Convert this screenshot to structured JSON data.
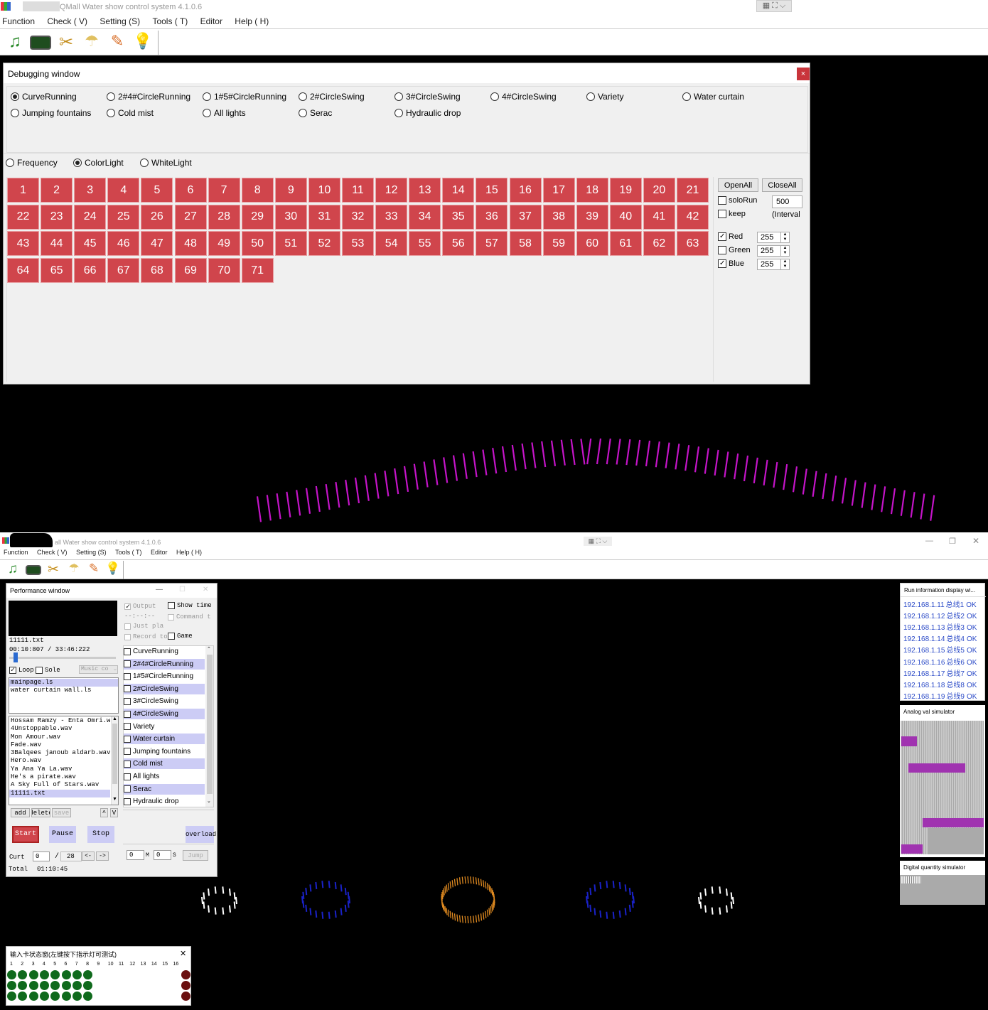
{
  "top": {
    "title": "QMall Water show control system 4.1.0.6",
    "menu": [
      "Function",
      "Check ( V)",
      "Setting (S)",
      "Tools ( T)",
      "Editor",
      "Help ( H)"
    ],
    "toolbar_icons": [
      "music-note-icon",
      "chip-board-icon",
      "tools-icon",
      "fountain-icon",
      "brush-icon",
      "bulb-icon"
    ]
  },
  "debug": {
    "title": "Debugging window",
    "close": "×",
    "effects": [
      {
        "label": "CurveRunning",
        "selected": true
      },
      {
        "label": "2#4#CircleRunning",
        "selected": false
      },
      {
        "label": "1#5#CircleRunning",
        "selected": false
      },
      {
        "label": "2#CircleSwing",
        "selected": false
      },
      {
        "label": "3#CircleSwing",
        "selected": false
      },
      {
        "label": "4#CircleSwing",
        "selected": false
      },
      {
        "label": "Variety",
        "selected": false
      },
      {
        "label": "Water curtain",
        "selected": false
      },
      {
        "label": "Jumping fountains",
        "selected": false
      },
      {
        "label": "Cold mist",
        "selected": false
      },
      {
        "label": "All lights",
        "selected": false
      },
      {
        "label": "Serac",
        "selected": false
      },
      {
        "label": "Hydraulic drop",
        "selected": false
      }
    ],
    "modes": [
      {
        "label": "Frequency",
        "selected": false
      },
      {
        "label": "ColorLight",
        "selected": true
      },
      {
        "label": "WhiteLight",
        "selected": false
      }
    ],
    "channels": [
      "1",
      "2",
      "3",
      "4",
      "5",
      "6",
      "7",
      "8",
      "9",
      "10",
      "11",
      "12",
      "13",
      "14",
      "15",
      "16",
      "17",
      "18",
      "19",
      "20",
      "21",
      "22",
      "23",
      "24",
      "25",
      "26",
      "27",
      "28",
      "29",
      "30",
      "31",
      "32",
      "33",
      "34",
      "35",
      "36",
      "37",
      "38",
      "39",
      "40",
      "41",
      "42",
      "43",
      "44",
      "45",
      "46",
      "47",
      "48",
      "49",
      "50",
      "51",
      "52",
      "53",
      "54",
      "55",
      "56",
      "57",
      "58",
      "59",
      "60",
      "61",
      "62",
      "63",
      "64",
      "65",
      "66",
      "67",
      "68",
      "69",
      "70",
      "71"
    ],
    "open_all": "OpenAll",
    "close_all": "CloseAll",
    "solo_run": "soloRun",
    "keep": "keep",
    "interval_value": "500",
    "interval_label": "(Interval",
    "colors": [
      {
        "label": "Red",
        "checked": true,
        "value": "255"
      },
      {
        "label": "Green",
        "checked": false,
        "value": "255"
      },
      {
        "label": "Blue",
        "checked": true,
        "value": "255"
      }
    ]
  },
  "bottom": {
    "title": "all Water show control system 4.1.0.6",
    "menu": [
      "Function",
      "Check ( V)",
      "Setting (S)",
      "Tools ( T)",
      "Editor",
      "Help ( H)"
    ],
    "perf": {
      "title": "Performance window",
      "file": "11111.txt",
      "time": "00:10:807 / 33:46:222",
      "progress": 0.02,
      "loop": "Loop",
      "sole": "Sole",
      "music_combo": "Music co",
      "output": "Output",
      "show_time": "Show time",
      "time_placeholder": "--:--:--",
      "command": "Command t",
      "just_play": "Just pla",
      "record_to": "Record to",
      "game": "Game",
      "scripts": [
        {
          "name": "mainpage.ls",
          "selected": true
        },
        {
          "name": "water curtain wall.ls",
          "selected": false
        }
      ],
      "songs": [
        {
          "name": "Hossam Ramzy - Enta Omri.wav",
          "selected": false
        },
        {
          "name": "4Unstoppable.wav",
          "selected": false
        },
        {
          "name": "Mon Amour.wav",
          "selected": false
        },
        {
          "name": "Fade.wav",
          "selected": false
        },
        {
          "name": "3Balqees janoub aldarb.wav",
          "selected": false
        },
        {
          "name": "Hero.wav",
          "selected": false
        },
        {
          "name": "Ya Ana Ya La.wav",
          "selected": false
        },
        {
          "name": "He's a pirate.wav",
          "selected": false
        },
        {
          "name": "A Sky Full of Stars.wav",
          "selected": false
        },
        {
          "name": "11111.txt",
          "selected": true
        }
      ],
      "effects": [
        {
          "label": "CurveRunning",
          "hl": false
        },
        {
          "label": "2#4#CircleRunning",
          "hl": true
        },
        {
          "label": "1#5#CircleRunning",
          "hl": false
        },
        {
          "label": "2#CircleSwing",
          "hl": true
        },
        {
          "label": "3#CircleSwing",
          "hl": false
        },
        {
          "label": "4#CircleSwing",
          "hl": true
        },
        {
          "label": "Variety",
          "hl": false
        },
        {
          "label": "Water curtain",
          "hl": true
        },
        {
          "label": "Jumping fountains",
          "hl": false
        },
        {
          "label": "Cold mist",
          "hl": true
        },
        {
          "label": "All lights",
          "hl": false
        },
        {
          "label": "Serac",
          "hl": true
        },
        {
          "label": "Hydraulic drop",
          "hl": false
        }
      ],
      "add": "add",
      "delete": "delete",
      "save": "save",
      "up": "^",
      "down": "V",
      "start": "Start",
      "pause": "Pause",
      "stop": "Stop",
      "overload": "overload",
      "curt": "Curt",
      "curt_value": "0",
      "slash": "/",
      "total_count": "28",
      "prev": "<-",
      "next": "->",
      "m_value": "0",
      "m_label": "M",
      "s_value": "0",
      "s_label": "S",
      "jump": "Jump",
      "total_label": "Total",
      "total_time": "01:10:45"
    },
    "runinfo": {
      "title": "Run information display wi...",
      "rows": [
        {
          "ip": "192.168.1.11",
          "line": "总线1",
          "status": "OK"
        },
        {
          "ip": "192.168.1.12",
          "line": "总线2",
          "status": "OK"
        },
        {
          "ip": "192.168.1.13",
          "line": "总线3",
          "status": "OK"
        },
        {
          "ip": "192.168.1.14",
          "line": "总线4",
          "status": "OK"
        },
        {
          "ip": "192.168.1.15",
          "line": "总线5",
          "status": "OK"
        },
        {
          "ip": "192.168.1.16",
          "line": "总线6",
          "status": "OK"
        },
        {
          "ip": "192.168.1.17",
          "line": "总线7",
          "status": "OK"
        },
        {
          "ip": "192.168.1.18",
          "line": "总线8",
          "status": "OK"
        },
        {
          "ip": "192.168.1.19",
          "line": "总线9",
          "status": "OK"
        }
      ]
    },
    "analog_title": "Analog val simulator",
    "digital_title": "Digital quantity simulator",
    "input_card": {
      "title": "输入卡状态窗(左键按下指示灯可测试)",
      "close": "✕",
      "numbers": [
        "1",
        "2",
        "3",
        "4",
        "5",
        "6",
        "7",
        "8",
        "9",
        "10",
        "11",
        "12",
        "13",
        "14",
        "15",
        "16"
      ]
    }
  }
}
